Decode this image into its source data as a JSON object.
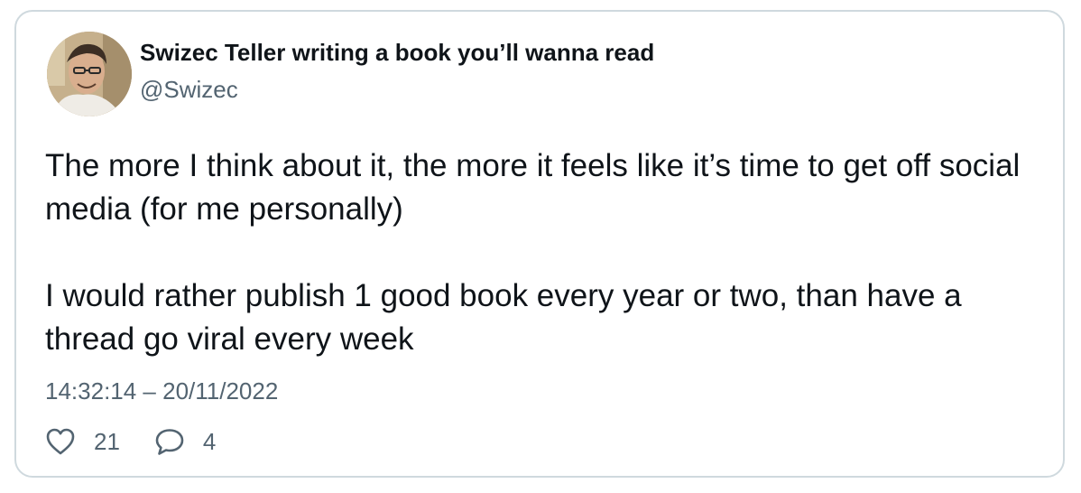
{
  "tweet": {
    "display_name": "Swizec Teller writing a book you’ll wanna read",
    "handle": "@Swizec",
    "paragraphs": [
      "The more I think about it, the more it feels like it’s time to get off social media (for me personally)",
      "I would rather publish 1 good book every year or two, than have a thread go viral every week"
    ],
    "timestamp": "14:32:14 – 20/11/2022",
    "likes": "21",
    "replies": "4"
  },
  "icons": {
    "like": "heart-icon",
    "reply": "speech-bubble-icon"
  },
  "colors": {
    "text": "#0f1419",
    "secondary": "#536471",
    "border": "#cfd9de"
  }
}
